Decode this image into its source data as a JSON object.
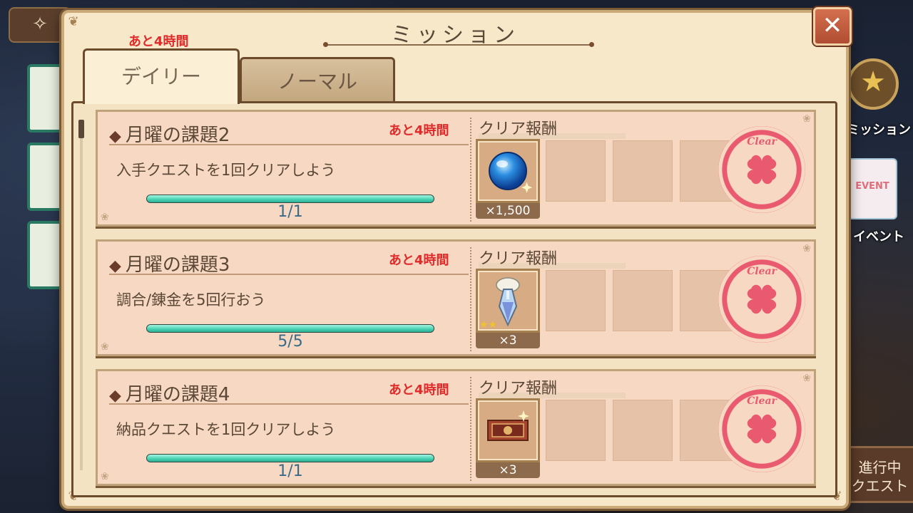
{
  "dialog": {
    "title": "ミッション",
    "close_label": "✕",
    "timer": "あと4時間"
  },
  "tabs": [
    {
      "label": "デイリー",
      "active": true
    },
    {
      "label": "ノーマル",
      "active": false
    }
  ],
  "background": {
    "mission_btn": "ミッション",
    "event_btn": "イベント",
    "event_card": "EVENT",
    "progress_btn_line1": "進行中",
    "progress_btn_line2": "クエスト"
  },
  "missions": [
    {
      "title": "月曜の課題2",
      "timer": "あと4時間",
      "description": "入手クエストを1回クリアしよう",
      "progress_text": "1/1",
      "progress": 1.0,
      "reward_label": "クリア報酬",
      "reward_icon": "blue-orb-icon",
      "reward_qty": "×1,500",
      "stamp": "Clear"
    },
    {
      "title": "月曜の課題3",
      "timer": "あと4時間",
      "description": "調合/錬金を5回行おう",
      "progress_text": "5/5",
      "progress": 1.0,
      "reward_label": "クリア報酬",
      "reward_icon": "potion-icon",
      "reward_qty": "×3",
      "reward_stars": "★★",
      "stamp": "Clear"
    },
    {
      "title": "月曜の課題4",
      "timer": "あと4時間",
      "description": "納品クエストを1回クリアしよう",
      "progress_text": "1/1",
      "progress": 1.0,
      "reward_label": "クリア報酬",
      "reward_icon": "ticket-icon",
      "reward_qty": "×3",
      "stamp": "Clear"
    }
  ],
  "colors": {
    "timer_red": "#e02a2a",
    "progress_green": "#45d1b2",
    "stamp_pink": "#e95a70",
    "panel_beige": "#f6e8c9"
  }
}
